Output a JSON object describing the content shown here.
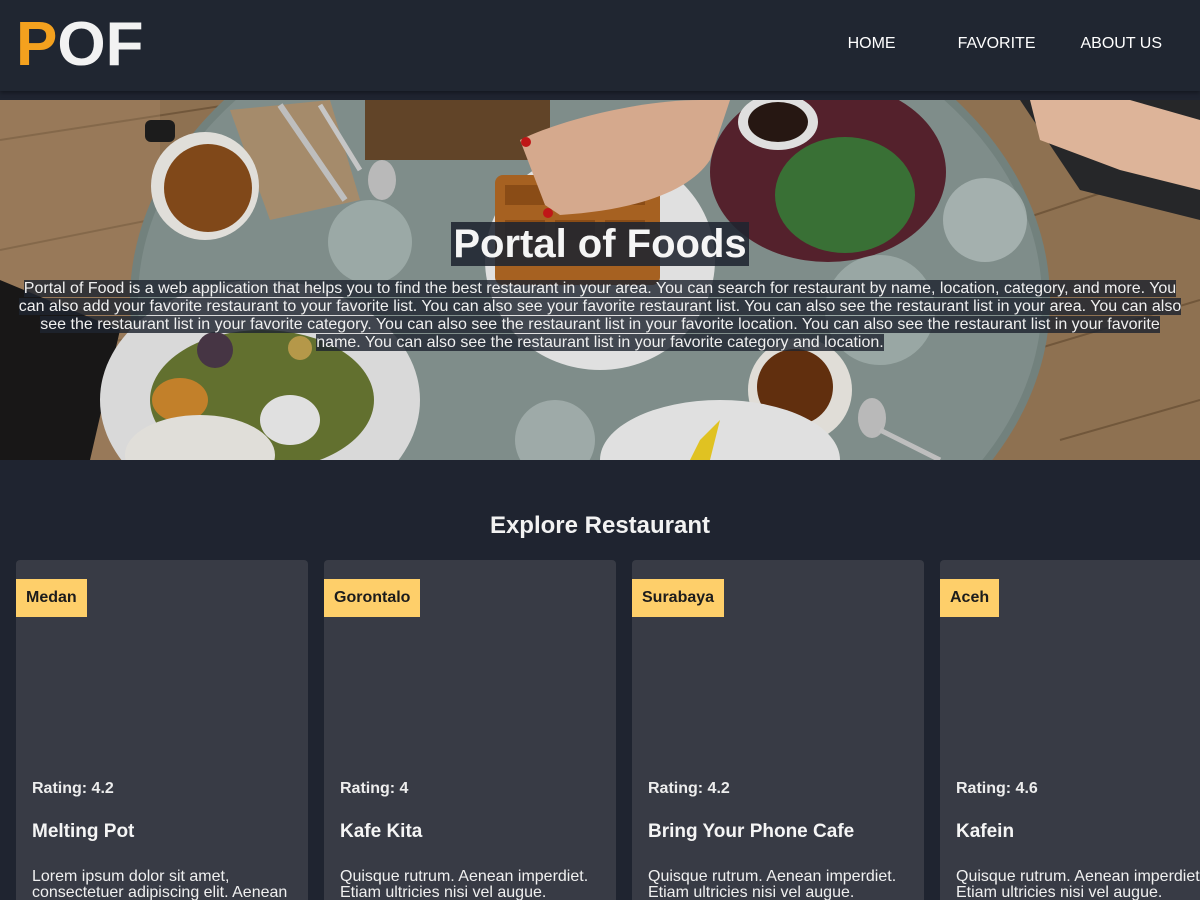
{
  "header": {
    "logo_first": "P",
    "logo_rest": "OF",
    "nav": [
      {
        "label": "HOME"
      },
      {
        "label": "FAVORITE"
      },
      {
        "label": "ABOUT US"
      }
    ]
  },
  "hero": {
    "title": "Portal of Foods",
    "description": "Portal of Food is a web application that helps you to find the best restaurant in your area. You can search for restaurant by name, location, category, and more. You can also add your favorite restaurant to your favorite list. You can also see your favorite restaurant list. You can also see the restaurant list in your area. You can also see the restaurant list in your favorite category. You can also see the restaurant list in your favorite location. You can also see the restaurant list in your favorite name. You can also see the restaurant list in your favorite category and location."
  },
  "explore": {
    "title": "Explore Restaurant",
    "restaurants": [
      {
        "city": "Medan",
        "rating": "Rating: 4.2",
        "name": "Melting Pot",
        "description": "Lorem ipsum dolor sit amet, consectetuer adipiscing elit. Aenean"
      },
      {
        "city": "Gorontalo",
        "rating": "Rating: 4",
        "name": "Kafe Kita",
        "description": "Quisque rutrum. Aenean imperdiet. Etiam ultricies nisi vel augue."
      },
      {
        "city": "Surabaya",
        "rating": "Rating: 4.2",
        "name": "Bring Your Phone Cafe",
        "description": "Quisque rutrum. Aenean imperdiet. Etiam ultricies nisi vel augue."
      },
      {
        "city": "Aceh",
        "rating": "Rating: 4.6",
        "name": "Kafein",
        "description": "Quisque rutrum. Aenean imperdiet. Etiam ultricies nisi vel augue."
      }
    ]
  },
  "colors": {
    "background": "#1f2430",
    "header": "#202631",
    "card": "#383b45",
    "city_badge": "#fecf6a",
    "logo_accent": "#f4a11e"
  }
}
